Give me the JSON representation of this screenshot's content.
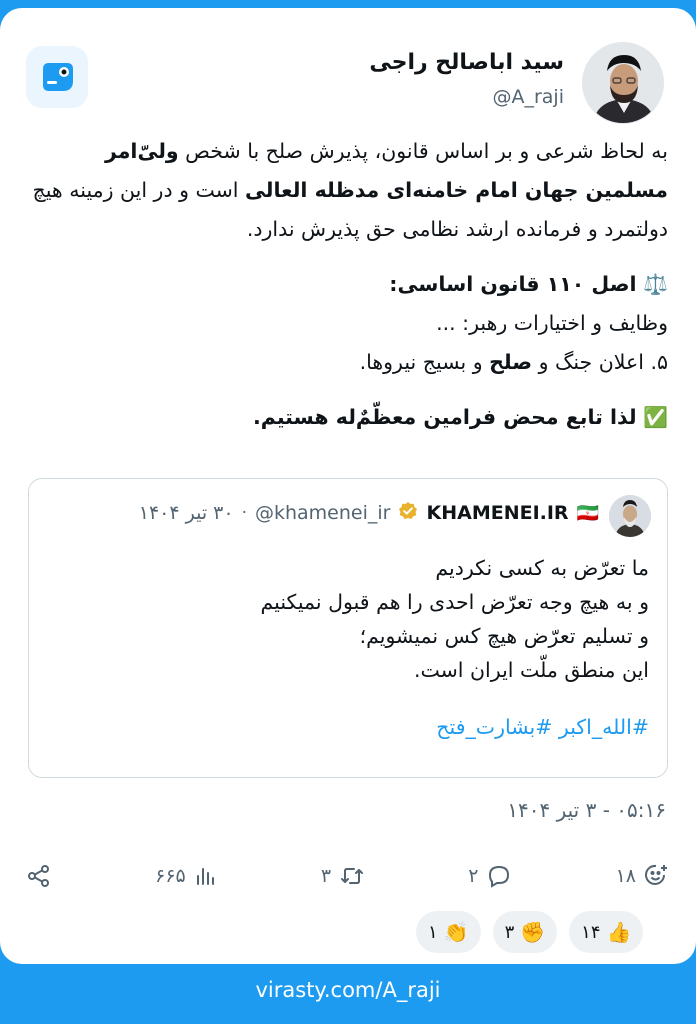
{
  "author": {
    "display_name": "سید اباصالح راجی",
    "handle": "@A_raji"
  },
  "post": {
    "p1_a": "به لحاظ شرعی و بر اساس قانون، پذیرش صلح با شخص ",
    "p1_b": "ولیّ‌امر مسلمین جهان امام خامنه‌ای مدظله العالی",
    "p1_c": " است و در این زمینه هیچ دولتمرد و فرمانده ارشد نظامی حق پذیرش ندارد.",
    "law_title": "اصل ۱۱۰ قانون اساسی:",
    "law_line1": "وظایف و اختیارات رهبر: ...",
    "law_line2_a": "۵. اعلان جنگ و ",
    "law_line2_b": "صلح",
    "law_line2_c": " و بسیج نیروها.",
    "closing": "لذا تابع محض فرامین معظّمٌ‌له هستیم.",
    "scale_emoji": "⚖️",
    "check_emoji": "✅"
  },
  "quote": {
    "name": "KHAMENEI.IR",
    "flag": "🇮🇷",
    "handle": "@khamenei_ir",
    "dot": "·",
    "time": "۳۰ تیر ۱۴۰۴",
    "lines": [
      "ما تعرّض به کسی نکردیم",
      "و به هیچ وجه تعرّض احدی را هم قبول نمیکنیم",
      "و تسلیم تعرّض هیچ کس نمیشویم؛",
      "این منطق ملّت ایران است."
    ],
    "hashtags": "#الله_اکبر #بشارت_فتح"
  },
  "timestamp": "۰۵:۱۶ - ۳ تیر ۱۴۰۴",
  "actions": {
    "reactions_count": "۱۸",
    "replies_count": "۲",
    "reposts_count": "۳",
    "views_count": "۶۶۵"
  },
  "reaction_pills": [
    {
      "emoji": "👍",
      "count": "۱۴"
    },
    {
      "emoji": "✊",
      "count": "۳"
    },
    {
      "emoji": "👏",
      "count": "۱"
    }
  ],
  "footer": "virasty.com/A_raji",
  "colors": {
    "accent": "#1d9bf0",
    "muted": "#536471",
    "text": "#0f1419"
  },
  "icons": [
    "app-logo-icon",
    "verified-badge-icon",
    "add-reaction-icon",
    "reply-icon",
    "repost-icon",
    "views-icon",
    "share-icon"
  ]
}
